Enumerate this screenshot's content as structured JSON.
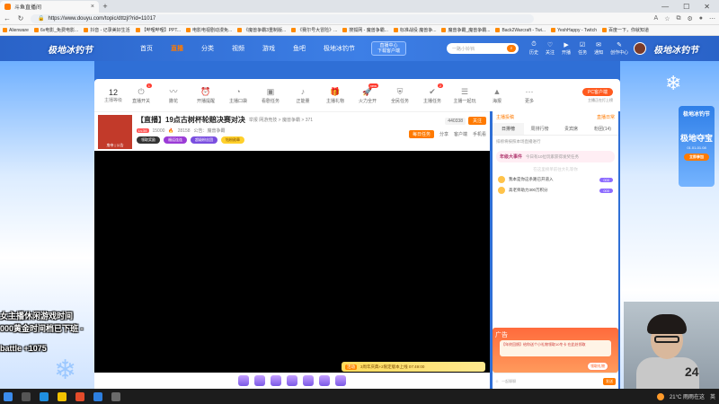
{
  "browser": {
    "tab_title": "斗鱼直播间",
    "url": "https://www.douyu.com/topic/dttzjl?rid=11017",
    "bookmarks": [
      "Alienware",
      "6v电影_免费电影...",
      "抖音 - 记录美好生活",
      "【哔哩哔哩】PPT...",
      "电影电视剧动漫免...",
      "《魔兽争霸3重制版...",
      "《赛尔号大冒险》...",
      "搜狐网 - 魔兽争霸...",
      "标准战役 魔兽争...",
      "魔兽争霸_魔兽争霸...",
      "Back2Warcraft - Twi...",
      "YeshHappy - Twitch",
      "百度一下，你就知道"
    ]
  },
  "header": {
    "logo_text": "极地冰钓节",
    "nav": [
      "首页",
      "直播",
      "分类",
      "视频",
      "游戏",
      "鱼吧",
      "极地冰钓节"
    ],
    "sub_pill": [
      "直播中心",
      "下载客户端"
    ],
    "search_placeholder": "一路小铃铛",
    "icons": [
      "历史",
      "关注",
      "开播",
      "任务",
      "通知",
      "创作中心"
    ],
    "right_logo": "极地冰钓节"
  },
  "toolbar": {
    "fav_count": "12",
    "fav_label": "主播等级",
    "tools": [
      {
        "label": "直播开关",
        "badge": "1"
      },
      {
        "label": "撒花",
        "badge": ""
      },
      {
        "label": "开播提醒",
        "badge": ""
      },
      {
        "label": "主播口袋",
        "badge": ""
      },
      {
        "label": "看剧任务",
        "badge": ""
      },
      {
        "label": "正能量",
        "badge": ""
      },
      {
        "label": "主播礼物",
        "badge": ""
      },
      {
        "label": "火力全开",
        "badge": "new"
      },
      {
        "label": "全民任务",
        "badge": ""
      },
      {
        "label": "主播任务",
        "badge": "2"
      },
      {
        "label": "主播一起玩",
        "badge": ""
      },
      {
        "label": "海报",
        "badge": ""
      },
      {
        "label": "更多",
        "badge": ""
      }
    ],
    "pc_client": "PC客户端",
    "pc_client_sub": "主播正在打上榜"
  },
  "anchor": {
    "avatar_caption": "鬼帝 | 公告",
    "title": "【直播】19点古树杯轮赔决赛对决",
    "meta": "举报  网游竞技 > 魔兽争霸 > 371",
    "level": "Lv.34",
    "id": "15000",
    "hot": "28158",
    "notice": "公告：魔兽争霸",
    "tags": [
      "领取奖励",
      "福运连连",
      "超级粉丝团",
      "钻粉勋章"
    ],
    "follow_count": "440338",
    "follow_label": "关注",
    "task_label": "每日任务",
    "actions": [
      "分享",
      "客户端",
      "手机看"
    ]
  },
  "video": {
    "banner_icon": "活动",
    "banner_text": "3周年庆典+2限定版本上线 07:49:00"
  },
  "side": {
    "top_left": "主播投稿",
    "top_right": "直播日常",
    "tabs": [
      "日排榜",
      "周排行榜",
      "贵宾席",
      "粉团(14)"
    ],
    "note": "排榜将按照本场直播进行",
    "event_title": "年级大事件",
    "event_text": "今日有10位玩家获得发奖任务",
    "hint": "在这里榜单前往大礼等你",
    "rank": [
      {
        "name": "我本是你这条路已开道入",
        "value": "000"
      },
      {
        "name": "高老师助力300万积分",
        "value": "000"
      }
    ],
    "ad_label": "广告",
    "ad_text": "【年终回馈】给你送个小礼物领取10冬卡 在此处领取",
    "ad_button": "领取礼物",
    "chat_placeholder": "一起聊聊",
    "chat_send": "发送"
  },
  "promo": {
    "top": "极地冰钓节",
    "big": "极地夺宝",
    "date": "01.01-01.08",
    "btn": "立即参加"
  },
  "overlay": {
    "line1": "女主播休闲游戏时间",
    "line2": "000黄金时间档已下班 -",
    "line3": "battle +1075"
  },
  "webcam": {
    "number": "24"
  },
  "taskbar": {
    "temperature": "21°C  雨雨在这",
    "tray": "英"
  }
}
